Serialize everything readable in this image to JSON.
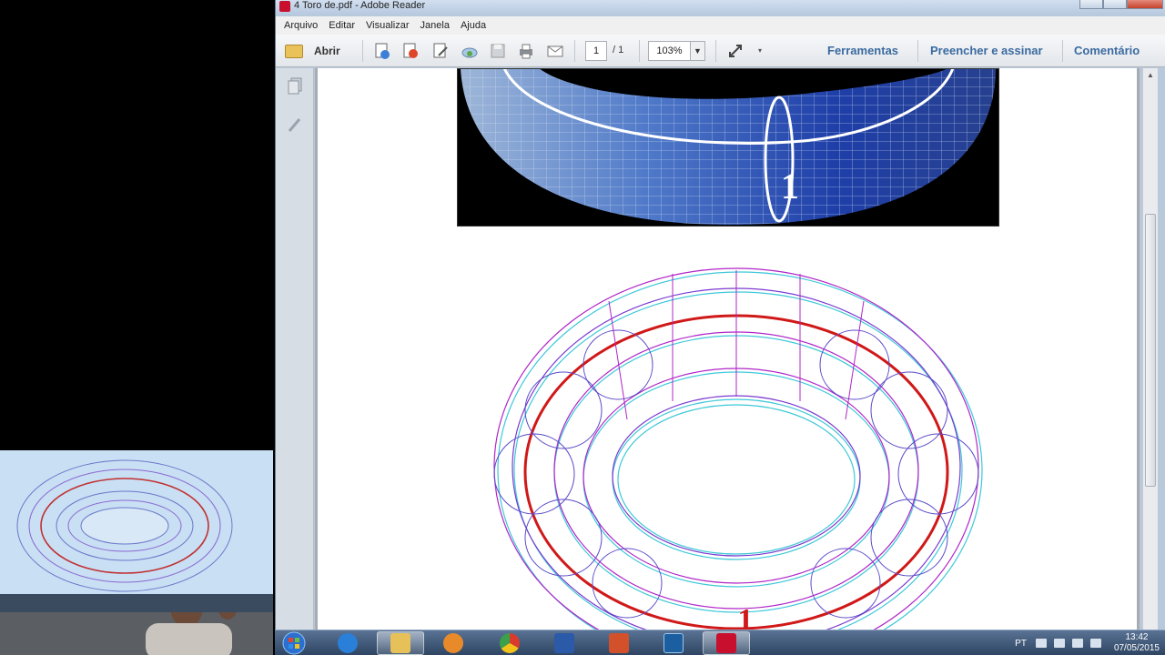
{
  "window": {
    "title": "4 Toro de.pdf - Adobe Reader"
  },
  "menu": [
    "Arquivo",
    "Editar",
    "Visualizar",
    "Janela",
    "Ajuda"
  ],
  "toolbar": {
    "open_label": "Abrir",
    "page_current": "1",
    "page_total": "/ 1",
    "zoom": "103%",
    "tools_label": "Ferramentas",
    "fill_sign_label": "Preencher e assinar",
    "comment_label": "Comentário"
  },
  "document": {
    "figure_label": "1"
  },
  "taskbar": {
    "language": "PT",
    "time": "13:42",
    "date": "07/05/2015"
  },
  "colors": {
    "accent_link": "#3a6aa0",
    "torus_blue": "#1f3fa8",
    "wire_magenta": "#b026c8",
    "wire_cyan": "#3ec8d8",
    "wire_red": "#d01818"
  },
  "icons": [
    "folder-icon",
    "create-pdf-icon",
    "export-icon",
    "edit-icon",
    "cloud-icon",
    "save-icon",
    "print-icon",
    "mail-icon",
    "fit-page-icon",
    "pages-icon",
    "signature-icon"
  ]
}
